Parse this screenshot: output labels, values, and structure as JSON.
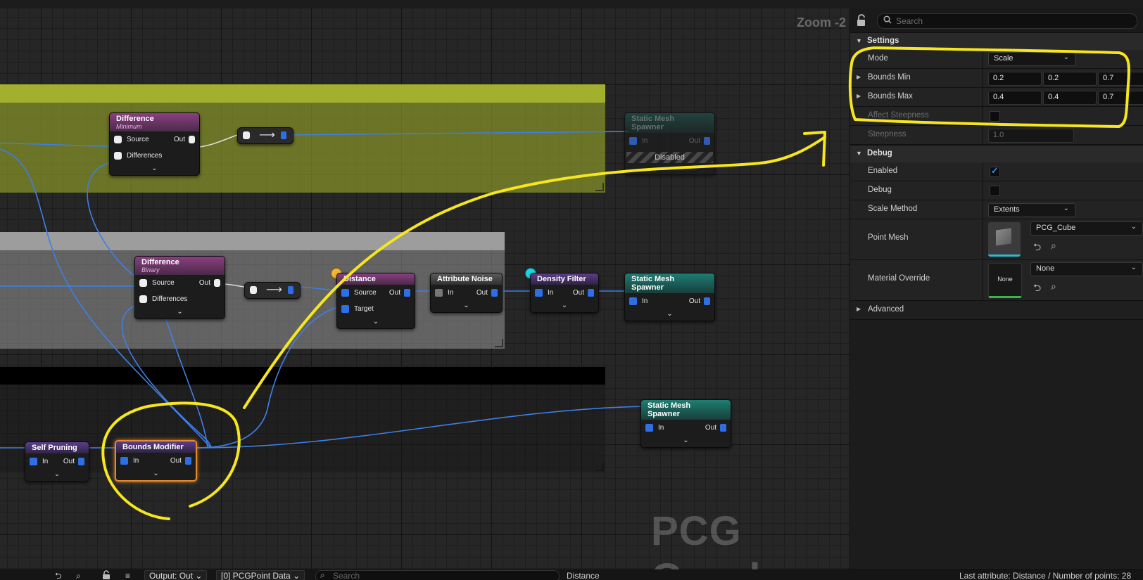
{
  "graph": {
    "zoom_label": "Zoom -2",
    "watermark": "PCG Graph",
    "nodes": {
      "diff1": {
        "title": "Difference",
        "subtitle": "Minimum",
        "source": "Source",
        "differences": "Differences",
        "out": "Out"
      },
      "sms_disabled": {
        "title": "Static Mesh Spawner",
        "in": "In",
        "out": "Out",
        "disabled": "Disabled"
      },
      "diff2": {
        "title": "Difference",
        "subtitle": "Binary",
        "source": "Source",
        "differences": "Differences",
        "out": "Out"
      },
      "distance": {
        "title": "Distance",
        "source": "Source",
        "target": "Target",
        "out": "Out"
      },
      "attr_noise": {
        "title": "Attribute Noise",
        "in": "In",
        "out": "Out"
      },
      "density_filter": {
        "title": "Density Filter",
        "in": "In",
        "out": "Out"
      },
      "sms2": {
        "title": "Static Mesh Spawner",
        "in": "In",
        "out": "Out"
      },
      "sms3": {
        "title": "Static Mesh Spawner",
        "in": "In",
        "out": "Out"
      },
      "self_pruning": {
        "title": "Self Pruning",
        "in": "In",
        "out": "Out"
      },
      "bounds_modifier": {
        "title": "Bounds Modifier",
        "in": "In",
        "out": "Out"
      }
    },
    "expand_glyph": "⌄",
    "arrow_glyph": "⟶",
    "colors": {
      "selected_outline": "#e88a2a",
      "annotation": "#f5e61e",
      "pin_blue": "#2f6fe6"
    }
  },
  "details": {
    "search_placeholder": "Search",
    "settings_label": "Settings",
    "mode_label": "Mode",
    "mode_value": "Scale",
    "bounds_min_label": "Bounds Min",
    "bounds_min": [
      "0.2",
      "0.2",
      "0.7"
    ],
    "bounds_max_label": "Bounds Max",
    "bounds_max": [
      "0.4",
      "0.4",
      "0.7"
    ],
    "affect_steepness_label": "Affect Steepness",
    "steepness_label": "Steepness",
    "steepness_value": "1.0",
    "debug_section": "Debug",
    "enabled_label": "Enabled",
    "debug_label": "Debug",
    "scale_method_label": "Scale Method",
    "scale_method_value": "Extents",
    "point_mesh_label": "Point Mesh",
    "point_mesh_value": "PCG_Cube",
    "material_override_label": "Material Override",
    "material_override_value": "None",
    "material_thumb_text": "None",
    "advanced_label": "Advanced"
  },
  "bottom": {
    "output_dropdown": "Output: Out",
    "data_dropdown": "[0] PCGPoint Data",
    "search_placeholder": "Search",
    "node_name": "Distance",
    "status": "Last attribute: Distance / Number of points: 28"
  }
}
